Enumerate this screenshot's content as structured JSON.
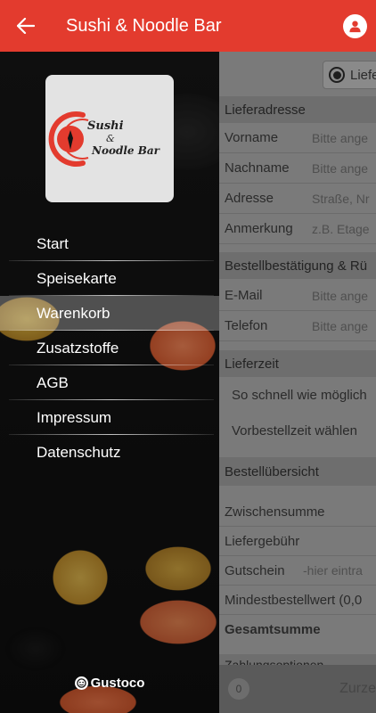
{
  "app": {
    "title": "Sushi & Noodle Bar",
    "accent": "#e33b2e"
  },
  "drawer": {
    "logo": {
      "line1": "Sushi",
      "amp": "&",
      "line2": "Noodle Bar"
    },
    "items": [
      {
        "label": "Start",
        "active": false
      },
      {
        "label": "Speisekarte",
        "active": false
      },
      {
        "label": "Warenkorb",
        "active": true
      },
      {
        "label": "Zusatzstoffe",
        "active": false
      },
      {
        "label": "AGB",
        "active": false
      },
      {
        "label": "Impressum",
        "active": false
      },
      {
        "label": "Datenschutz",
        "active": false
      }
    ],
    "brand": "Gustoco"
  },
  "page": {
    "radio_label": "Liefe",
    "delivery_header": "Lieferadresse",
    "fields": [
      {
        "label": "Vorname",
        "placeholder": "Bitte ange"
      },
      {
        "label": "Nachname",
        "placeholder": "Bitte ange"
      },
      {
        "label": "Adresse",
        "placeholder": "Straße, Nr"
      },
      {
        "label": "Anmerkung",
        "placeholder": "z.B. Etage"
      }
    ],
    "confirm_header": "Bestellbestätigung & Rü",
    "contact": [
      {
        "label": "E-Mail",
        "placeholder": "Bitte ange"
      },
      {
        "label": "Telefon",
        "placeholder": "Bitte ange"
      }
    ],
    "time_header": "Lieferzeit",
    "time_options": [
      "So schnell wie möglich",
      "Vorbestellzeit wählen"
    ],
    "overview_header": "Bestellübersicht",
    "summary": [
      {
        "label": "Zwischensumme"
      },
      {
        "label": "Liefergebühr"
      },
      {
        "label": "Gutschein",
        "placeholder": "-hier eintra"
      },
      {
        "label": "Mindestbestellwert (0,0"
      }
    ],
    "total_label": "Gesamtsumme",
    "payment_header": "Zahlungsoptionen",
    "cart_count": "0",
    "back_label": "Zurze"
  }
}
